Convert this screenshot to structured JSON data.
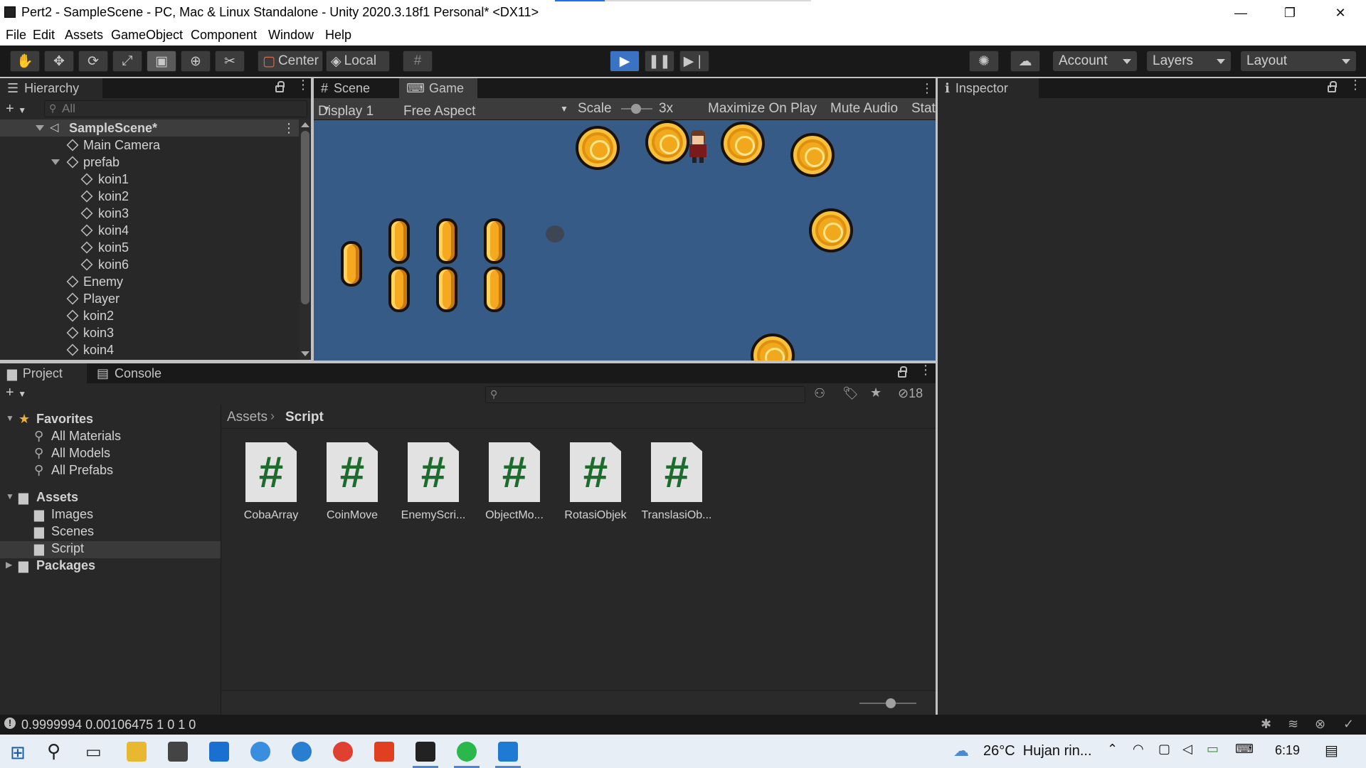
{
  "window": {
    "title": "Pert2 - SampleScene - PC, Mac & Linux Standalone - Unity 2020.3.18f1 Personal* <DX11>",
    "minimize": "—",
    "maximize": "❐",
    "close": "✕"
  },
  "menu": [
    "File",
    "Edit",
    "Assets",
    "GameObject",
    "Component",
    "Window",
    "Help"
  ],
  "toolbar": {
    "center": "Center",
    "local": "Local",
    "account": "Account",
    "layers": "Layers",
    "layout": "Layout"
  },
  "hierarchy": {
    "tab": "Hierarchy",
    "search_placeholder": "All",
    "items": [
      {
        "label": "SampleScene*"
      },
      {
        "label": "Main Camera"
      },
      {
        "label": "prefab"
      },
      {
        "label": "koin1"
      },
      {
        "label": "koin2"
      },
      {
        "label": "koin3"
      },
      {
        "label": "koin4"
      },
      {
        "label": "koin5"
      },
      {
        "label": "koin6"
      },
      {
        "label": "Enemy"
      },
      {
        "label": "Player"
      },
      {
        "label": "koin2"
      },
      {
        "label": "koin3"
      },
      {
        "label": "koin4"
      }
    ]
  },
  "scene_tabs": {
    "scene": "Scene",
    "game": "Game"
  },
  "gamebar": {
    "display": "Display 1",
    "aspect": "Free Aspect",
    "scale_label": "Scale",
    "scale_value": "3x",
    "maximize": "Maximize On Play",
    "mute": "Mute Audio",
    "stats": "Stat"
  },
  "inspector": {
    "tab": "Inspector"
  },
  "project": {
    "tabs": {
      "project": "Project",
      "console": "Console"
    },
    "hidden_count": "18",
    "favorites": {
      "header": "Favorites",
      "items": [
        "All Materials",
        "All Models",
        "All Prefabs"
      ]
    },
    "assets": {
      "header": "Assets",
      "items": [
        "Images",
        "Scenes",
        "Script"
      ]
    },
    "packages": "Packages",
    "breadcrumb": {
      "root": "Assets",
      "current": "Script"
    },
    "files": [
      "CobaArray",
      "CoinMove",
      "EnemyScri...",
      "ObjectMo...",
      "RotasiObjek",
      "TranslasiOb..."
    ]
  },
  "statusbar": {
    "message": "0.9999994 0.00106475 1 0 1 0"
  },
  "taskbar": {
    "weather": "26°C  Hujan rin...",
    "time": "6:19"
  },
  "colors": {
    "accent": "#4a8ad0",
    "gameview_bg": "#365b86",
    "editor_bg": "#282828"
  }
}
